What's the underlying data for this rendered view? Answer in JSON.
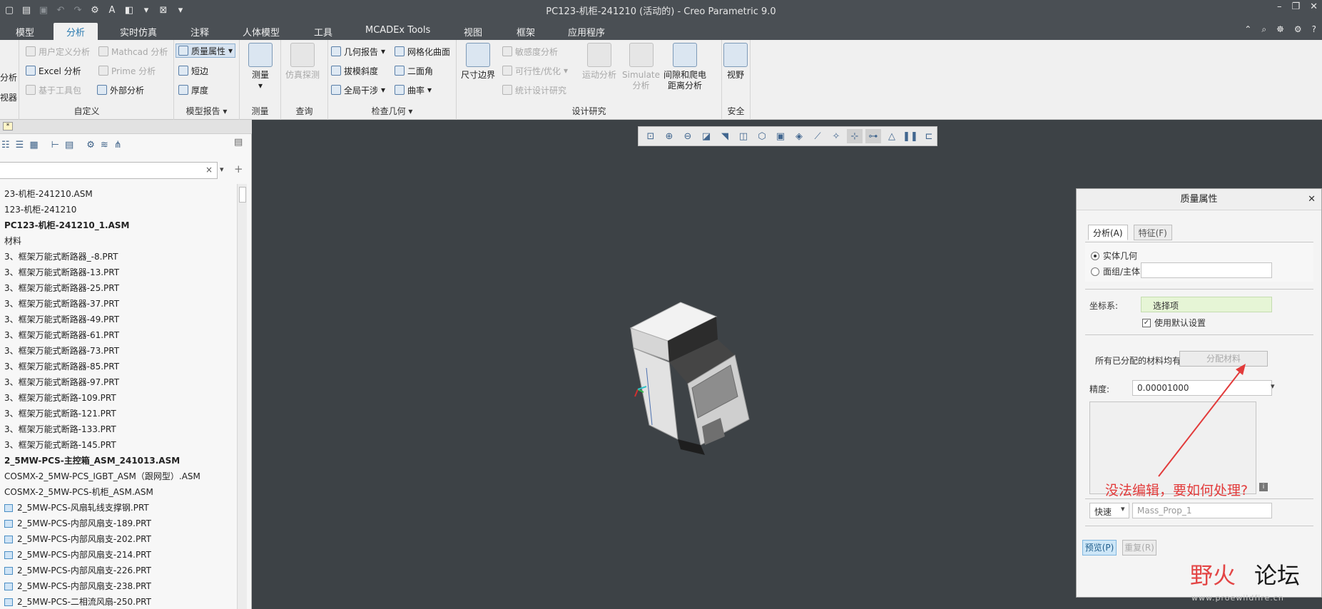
{
  "window": {
    "title": "PC123-机柜-241210 (活动的) - Creo Parametric 9.0"
  },
  "tabs": [
    {
      "label": "模型"
    },
    {
      "label": "分析"
    },
    {
      "label": "实时仿真"
    },
    {
      "label": "注释"
    },
    {
      "label": "人体模型"
    },
    {
      "label": "工具"
    },
    {
      "label": "MCADEx Tools"
    },
    {
      "label": "视图"
    },
    {
      "label": "框架"
    },
    {
      "label": "应用程序"
    }
  ],
  "ribbon": {
    "custom": {
      "left_items": [
        "分析",
        "视器"
      ],
      "items": [
        "用户定义分析",
        "Mathcad 分析",
        "Excel 分析",
        "Prime 分析",
        "基于工具包",
        "外部分析"
      ],
      "label": "自定义"
    },
    "model_report": {
      "items": [
        "质量属性",
        "短边",
        "厚度"
      ],
      "label": "模型报告"
    },
    "measure": {
      "button": "测量",
      "label": "测量"
    },
    "query": {
      "button": "仿真探测",
      "label": "查询"
    },
    "inspect": {
      "items": [
        "几何报告",
        "网格化曲面",
        "拔模斜度",
        "二面角",
        "全局干涉",
        "曲率"
      ],
      "label": "检查几何"
    },
    "design_study": {
      "dim_boundary": "尺寸边界",
      "items": [
        "敏感度分析",
        "可行性/优化",
        "统计设计研究"
      ],
      "motion": "运动分析",
      "simulate": [
        "Simulate",
        "分析"
      ],
      "clearance": [
        "间隙和爬电",
        "距离分析"
      ],
      "label": "设计研究"
    },
    "safety": {
      "button": "视野",
      "label": "安全"
    }
  },
  "tree": {
    "rows": [
      {
        "text": "23-机柜-241210.ASM",
        "bold": false,
        "icon": false
      },
      {
        "text": "123-机柜-241210",
        "bold": false,
        "icon": false
      },
      {
        "text": "PC123-机柜-241210_1.ASM",
        "bold": true,
        "icon": false
      },
      {
        "text": "材料",
        "bold": false,
        "icon": false
      },
      {
        "text": "3、框架万能式断路器_-8.PRT",
        "bold": false,
        "icon": false
      },
      {
        "text": "3、框架万能式断路器-13.PRT",
        "bold": false,
        "icon": false
      },
      {
        "text": "3、框架万能式断路器-25.PRT",
        "bold": false,
        "icon": false
      },
      {
        "text": "3、框架万能式断路器-37.PRT",
        "bold": false,
        "icon": false
      },
      {
        "text": "3、框架万能式断路器-49.PRT",
        "bold": false,
        "icon": false
      },
      {
        "text": "3、框架万能式断路器-61.PRT",
        "bold": false,
        "icon": false
      },
      {
        "text": "3、框架万能式断路器-73.PRT",
        "bold": false,
        "icon": false
      },
      {
        "text": "3、框架万能式断路器-85.PRT",
        "bold": false,
        "icon": false
      },
      {
        "text": "3、框架万能式断路器-97.PRT",
        "bold": false,
        "icon": false
      },
      {
        "text": "3、框架万能式断路-109.PRT",
        "bold": false,
        "icon": false
      },
      {
        "text": "3、框架万能式断路-121.PRT",
        "bold": false,
        "icon": false
      },
      {
        "text": "3、框架万能式断路-133.PRT",
        "bold": false,
        "icon": false
      },
      {
        "text": "3、框架万能式断路-145.PRT",
        "bold": false,
        "icon": false
      },
      {
        "text": "2_5MW-PCS-主控箱_ASM_241013.ASM",
        "bold": true,
        "icon": false
      },
      {
        "text": "COSMX-2_5MW-PCS_IGBT_ASM（跟网型）.ASM",
        "bold": false,
        "icon": false
      },
      {
        "text": "COSMX-2_5MW-PCS-机柜_ASM.ASM",
        "bold": false,
        "icon": false
      },
      {
        "text": "2_5MW-PCS-风扇轧线支撑钢.PRT",
        "bold": false,
        "icon": true
      },
      {
        "text": "2_5MW-PCS-内部风扇支-189.PRT",
        "bold": false,
        "icon": true
      },
      {
        "text": "2_5MW-PCS-内部风扇支-202.PRT",
        "bold": false,
        "icon": true
      },
      {
        "text": "2_5MW-PCS-内部风扇支-214.PRT",
        "bold": false,
        "icon": true
      },
      {
        "text": "2_5MW-PCS-内部风扇支-226.PRT",
        "bold": false,
        "icon": true
      },
      {
        "text": "2_5MW-PCS-内部风扇支-238.PRT",
        "bold": false,
        "icon": true
      },
      {
        "text": "2_5MW-PCS-二相流风扇-250.PRT",
        "bold": false,
        "icon": true
      }
    ]
  },
  "dialog": {
    "title": "质量属性",
    "tabs": [
      "分析(A)",
      "特征(F)"
    ],
    "radio_solid": "实体几何",
    "radio_quilt": "面组/主体:",
    "coord_label": "坐标系:",
    "coord_value": "选择项",
    "use_default": "使用默认设置",
    "materials_text": "所有已分配的材料均有效",
    "assign_button": "分配材料",
    "precision_label": "精度:",
    "precision_value": "0.00001000",
    "mode_value": "快速",
    "name_value": "Mass_Prop_1",
    "preview_button": "预览(P)",
    "repeat_button": "重复(R)",
    "annotation": "没法编辑，要如何处理?"
  },
  "watermark": {
    "red": "野火",
    "black": "论坛",
    "url": "www.proewildfire.cn"
  },
  "colors": {
    "titlebar": "#4a4f54",
    "accent": "#2a7ab0",
    "viewport": "#3d4246",
    "annotation": "#e23b3b"
  }
}
